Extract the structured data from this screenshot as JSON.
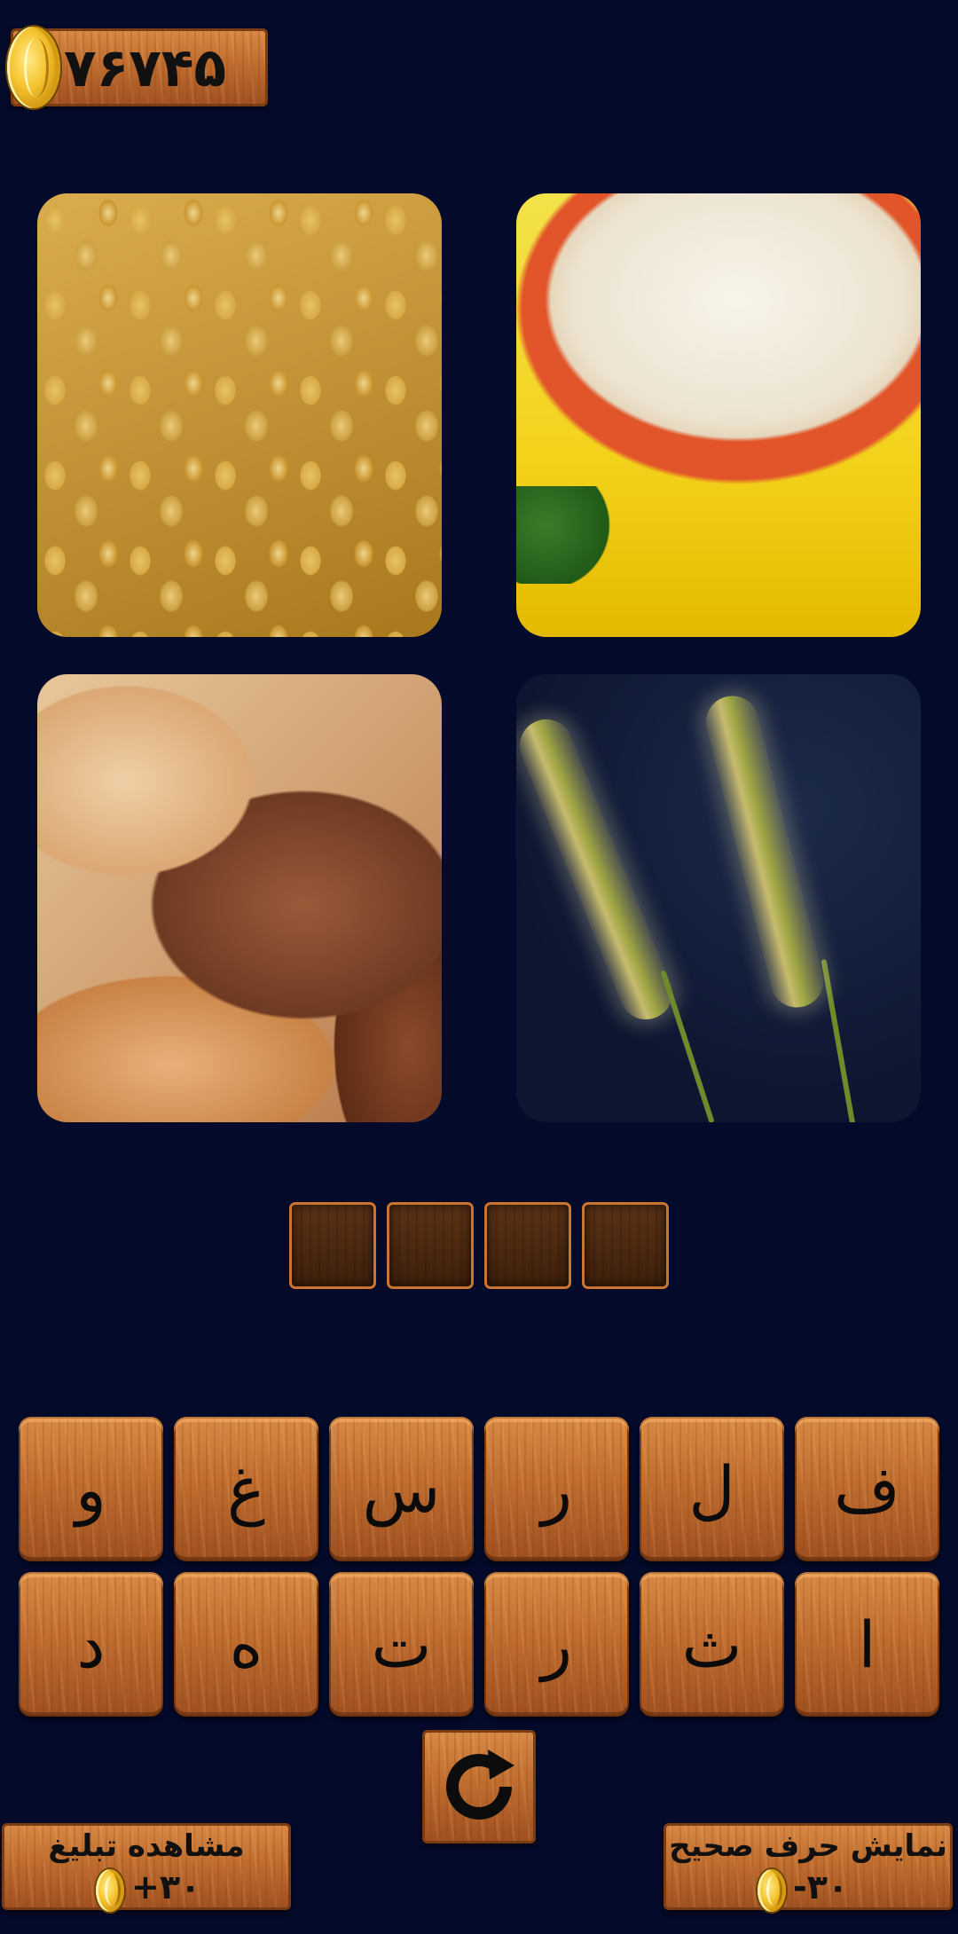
{
  "coins": {
    "count": "۷۶۷۴۵"
  },
  "images": [
    {
      "id": "wheat",
      "name": "wheat-grains-image"
    },
    {
      "id": "rice",
      "name": "rice-bowl-image"
    },
    {
      "id": "bread",
      "name": "bread-loaves-image"
    },
    {
      "id": "barley",
      "name": "barley-stalks-image"
    }
  ],
  "answer": {
    "slots": [
      "",
      "",
      "",
      ""
    ]
  },
  "letters": {
    "row1": [
      "و",
      "غ",
      "س",
      "ر",
      "ل",
      "ف"
    ],
    "row2": [
      "د",
      "ه",
      "ت",
      "ر",
      "ث",
      "ا"
    ]
  },
  "buttons": {
    "watch_ad": {
      "label": "مشاهده تبلیغ",
      "cost": "+۳۰"
    },
    "reveal_letter": {
      "label": "نمایش حرف صحیح",
      "cost": "-۳۰"
    },
    "refresh_icon": "refresh-icon"
  },
  "colors": {
    "background": "#040a2a",
    "wood": "#c06d2f",
    "slot": "#3e200b"
  }
}
